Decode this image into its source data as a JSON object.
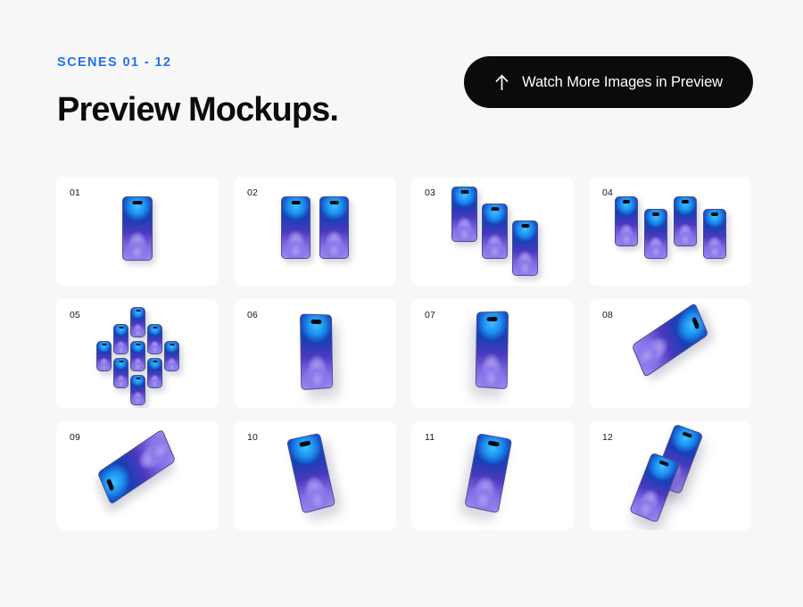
{
  "header": {
    "eyebrow": "SCENES 01 - 12",
    "title": "Preview Mockups.",
    "accent_color": "#2272e8",
    "title_color": "#0c0c0c"
  },
  "cta": {
    "label": "Watch More Images in Preview",
    "icon": "arrow-up-icon",
    "background_color": "#0b0b0b",
    "text_color": "#ffffff"
  },
  "page": {
    "background_color": "#f7f7f7",
    "card_background_color": "#ffffff"
  },
  "device": {
    "screen_top_color": "#1b8ef0",
    "screen_bottom_color": "#9d8bf0",
    "frame_color": "#4a4f8c"
  },
  "cards": [
    {
      "number": "01",
      "description": "single phone front view"
    },
    {
      "number": "02",
      "description": "two phones side by side"
    },
    {
      "number": "03",
      "description": "three phones descending stagger"
    },
    {
      "number": "04",
      "description": "four phones zigzag row"
    },
    {
      "number": "05",
      "description": "nine phones diamond grid"
    },
    {
      "number": "06",
      "description": "phone perspective turned left"
    },
    {
      "number": "07",
      "description": "phone perspective turned right"
    },
    {
      "number": "08",
      "description": "phone isometric lying flat"
    },
    {
      "number": "09",
      "description": "phone isometric lying flat mirrored"
    },
    {
      "number": "10",
      "description": "phone leaning left"
    },
    {
      "number": "11",
      "description": "phone leaning right"
    },
    {
      "number": "12",
      "description": "two phones floating overlapped"
    }
  ]
}
